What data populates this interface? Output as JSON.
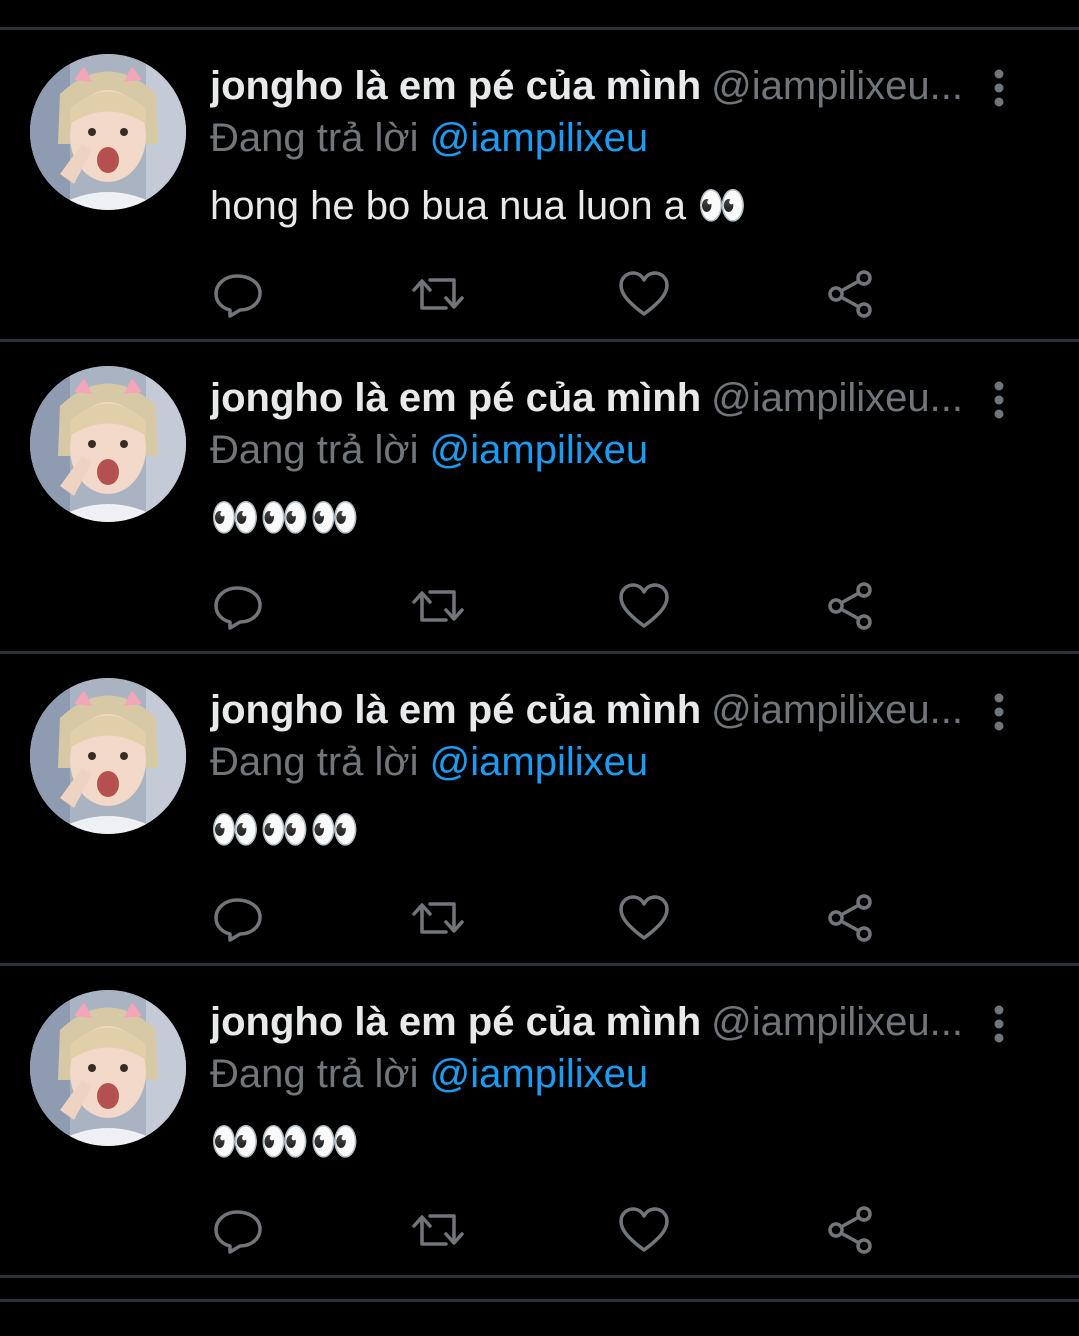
{
  "colors": {
    "background": "#000000",
    "divider": "#2f3336",
    "primary_text": "#e7e9ea",
    "secondary_text": "#71767b",
    "accent": "#1d9bf0"
  },
  "icons": {
    "reply": "reply-icon",
    "retweet": "retweet-icon",
    "like": "heart-icon",
    "share": "share-icon",
    "more": "more-vertical-icon"
  },
  "tweets": [
    {
      "display_name": "jongho là em pé của mình",
      "handle": "@iampilixeu...",
      "reply_prefix": "Đang trả lời",
      "reply_to": "@iampilixeu",
      "text": "hong he bo bua nua luon a 👀"
    },
    {
      "display_name": "jongho là em pé của mình",
      "handle": "@iampilixeu...",
      "reply_prefix": "Đang trả lời",
      "reply_to": "@iampilixeu",
      "text": "👀👀👀"
    },
    {
      "display_name": "jongho là em pé của mình",
      "handle": "@iampilixeu...",
      "reply_prefix": "Đang trả lời",
      "reply_to": "@iampilixeu",
      "text": "👀👀👀"
    },
    {
      "display_name": "jongho là em pé của mình",
      "handle": "@iampilixeu...",
      "reply_prefix": "Đang trả lời",
      "reply_to": "@iampilixeu",
      "text": "👀👀👀"
    }
  ]
}
